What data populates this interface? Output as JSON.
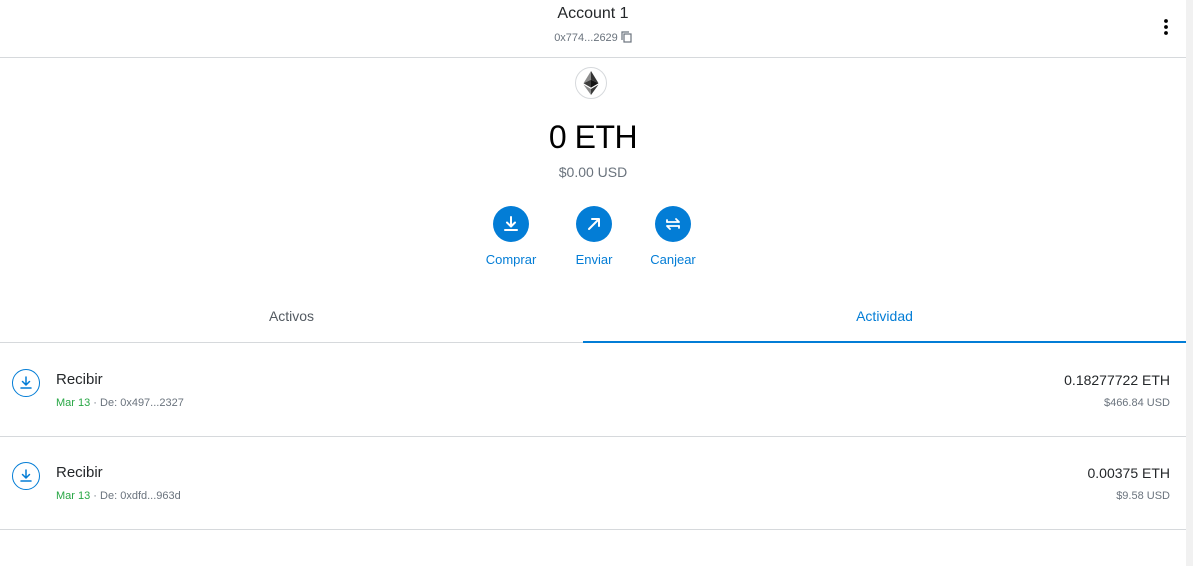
{
  "account": {
    "name": "Account 1",
    "address": "0x774...2629"
  },
  "balance": {
    "amount": "0 ETH",
    "fiat": "$0.00 USD"
  },
  "actions": [
    {
      "label": "Comprar",
      "icon": "download-icon"
    },
    {
      "label": "Enviar",
      "icon": "arrow-up-right-icon"
    },
    {
      "label": "Canjear",
      "icon": "swap-icon"
    }
  ],
  "tabs": [
    {
      "label": "Activos",
      "active": false
    },
    {
      "label": "Actividad",
      "active": true
    }
  ],
  "transactions": [
    {
      "title": "Recibir",
      "date": "Mar 13",
      "separator": " · ",
      "from": "De: 0x497...2327",
      "amount": "0.18277722 ETH",
      "usd": "$466.84 USD"
    },
    {
      "title": "Recibir",
      "date": "Mar 13",
      "separator": " · ",
      "from": "De: 0xdfd...963d",
      "amount": "0.00375 ETH",
      "usd": "$9.58 USD"
    }
  ],
  "colors": {
    "accent": "#037dd6",
    "success": "#28a745",
    "muted": "#6a737d",
    "border": "#d6d9dc"
  }
}
